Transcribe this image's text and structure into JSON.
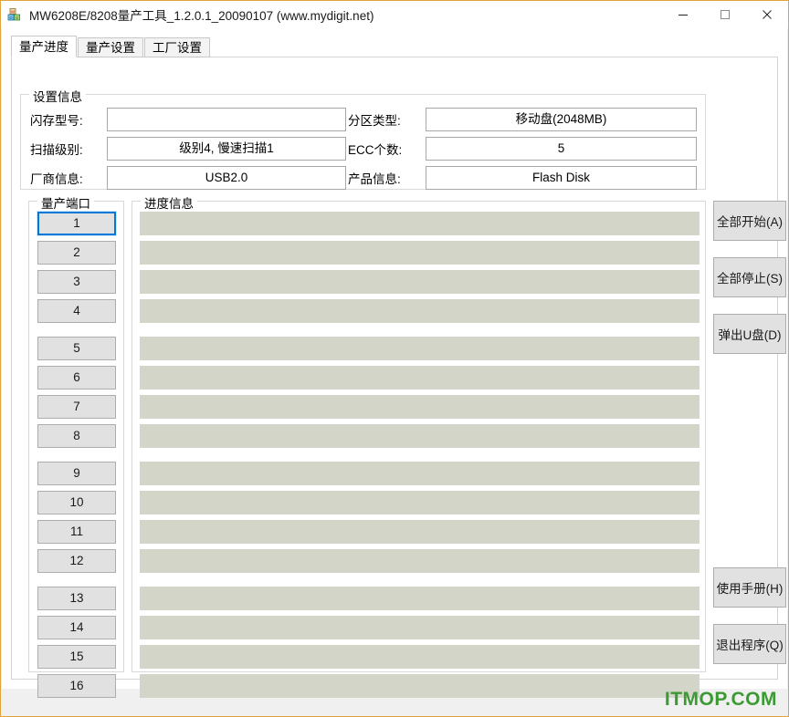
{
  "window": {
    "title": "MW6208E/8208量产工具_1.2.0.1_20090107 (www.mydigit.net)",
    "icon": "app-blocks-icon",
    "border_color": "#e3a33c",
    "controls": {
      "minimize": "—",
      "maximize": "□",
      "close": "✕"
    }
  },
  "tabs": [
    {
      "label": "量产进度",
      "active": true
    },
    {
      "label": "量产设置",
      "active": false
    },
    {
      "label": "工厂设置",
      "active": false
    }
  ],
  "settings_group": {
    "legend": "设置信息",
    "fields": [
      {
        "label": "闪存型号:",
        "value": ""
      },
      {
        "label": "扫描级别:",
        "value": "级别4, 慢速扫描1"
      },
      {
        "label": "厂商信息:",
        "value": "USB2.0"
      },
      {
        "label": "分区类型:",
        "value": "移动盘(2048MB)"
      },
      {
        "label": "ECC个数:",
        "value": "5"
      },
      {
        "label": "产品信息:",
        "value": "Flash Disk"
      }
    ]
  },
  "ports_group": {
    "legend": "量产端口",
    "focused_index": 0,
    "ports": [
      {
        "label": "1"
      },
      {
        "label": "2"
      },
      {
        "label": "3"
      },
      {
        "label": "4"
      },
      {
        "label": "5"
      },
      {
        "label": "6"
      },
      {
        "label": "7"
      },
      {
        "label": "8"
      },
      {
        "label": "9"
      },
      {
        "label": "10"
      },
      {
        "label": "11"
      },
      {
        "label": "12"
      },
      {
        "label": "13"
      },
      {
        "label": "14"
      },
      {
        "label": "15"
      },
      {
        "label": "16"
      }
    ]
  },
  "progress_group": {
    "legend": "进度信息",
    "bar_color": "#d3d5c9",
    "bars": [
      {
        "text": ""
      },
      {
        "text": ""
      },
      {
        "text": ""
      },
      {
        "text": ""
      },
      {
        "text": ""
      },
      {
        "text": ""
      },
      {
        "text": ""
      },
      {
        "text": ""
      },
      {
        "text": ""
      },
      {
        "text": ""
      },
      {
        "text": ""
      },
      {
        "text": ""
      },
      {
        "text": ""
      },
      {
        "text": ""
      },
      {
        "text": ""
      },
      {
        "text": ""
      }
    ]
  },
  "actions": {
    "start_all": "全部开始(A)",
    "stop_all": "全部停止(S)",
    "eject_udisk": "弹出U盘(D)",
    "manual": "使用手册(H)",
    "exit": "退出程序(Q)"
  },
  "watermark": {
    "text": "ITMOP.COM",
    "color": "#3c9a34"
  }
}
